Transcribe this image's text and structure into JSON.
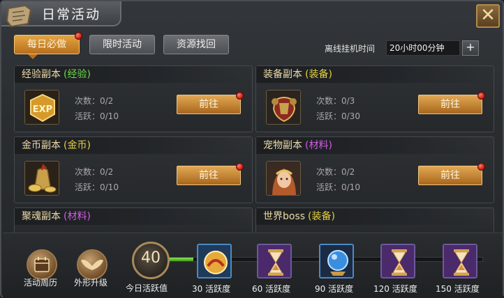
{
  "window": {
    "title": "日常活动",
    "close_label": "✕"
  },
  "tabs": [
    {
      "label": "每日必做",
      "active": true,
      "has_badge": true
    },
    {
      "label": "限时活动",
      "active": false
    },
    {
      "label": "资源找回",
      "active": false
    }
  ],
  "offline": {
    "label": "离线挂机时间",
    "value": "20小时00分钟",
    "add_label": "+"
  },
  "cards": [
    {
      "name": "经验副本",
      "tag": "(经验)",
      "tag_color": "green",
      "icon": "exp-icon",
      "count": "次数：0/2",
      "activity": "活跃：0/10",
      "button": "前往"
    },
    {
      "name": "装备副本",
      "tag": "(装备)",
      "tag_color": "yellow",
      "icon": "armor-icon",
      "count": "次数：0/3",
      "activity": "活跃：0/30",
      "button": "前往"
    },
    {
      "name": "金币副本",
      "tag": "(金币)",
      "tag_color": "yellow",
      "icon": "gold-bag-icon",
      "count": "次数：0/2",
      "activity": "活跃：0/10",
      "button": "前往"
    },
    {
      "name": "宠物副本",
      "tag": "(材料)",
      "tag_color": "purple",
      "icon": "pet-portrait-icon",
      "count": "次数：0/2",
      "activity": "活跃：0/10",
      "button": "前往"
    },
    {
      "name": "聚魂副本",
      "tag": "(材料)",
      "tag_color": "purple"
    },
    {
      "name": "世界boss",
      "tag": "(装备)",
      "tag_color": "yellow"
    }
  ],
  "bottom": {
    "calendar_label": "活动周历",
    "appearance_label": "外形升级",
    "today_activity_value": "40",
    "today_activity_label": "今日活跃值",
    "progress_fraction": 0.08,
    "rewards": [
      {
        "label": "30 活跃度",
        "icon": "gold-coin-chest-icon"
      },
      {
        "label": "60 活跃度",
        "icon": "hourglass-icon"
      },
      {
        "label": "90 活跃度",
        "icon": "crystal-orb-icon"
      },
      {
        "label": "120 活跃度",
        "icon": "hourglass-icon"
      },
      {
        "label": "150 活跃度",
        "icon": "hourglass-icon"
      }
    ]
  },
  "colors": {
    "accent": "#d9953a",
    "tag_green": "#6bd84a",
    "tag_yellow": "#e6d040",
    "tag_purple": "#d35be8",
    "progress": "#6dd23b"
  }
}
